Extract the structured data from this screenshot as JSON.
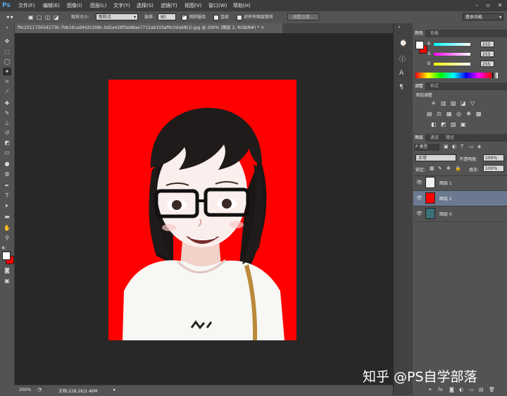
{
  "app": {
    "logo": "Ps"
  },
  "menu": [
    "文件(F)",
    "编辑(E)",
    "图像(I)",
    "图层(L)",
    "文字(Y)",
    "选择(S)",
    "滤镜(T)",
    "视图(V)",
    "窗口(W)",
    "帮助(H)"
  ],
  "options": {
    "sample_size_label": "取样大小:",
    "sample_size_value": "取样点",
    "tolerance_label": "容差:",
    "tolerance_value": "80",
    "antialias_label": "消除锯齿",
    "contiguous_label": "连续",
    "sample_all_label": "对所有图层取样",
    "refine_edge_button": "调整边缘...",
    "workspace_value": "基本功能"
  },
  "document": {
    "tab_title": "f9c23117565d273b-7bb16cad442c208c-0d2a428f3e98ae7712ab103af9c0da68(1).jpg @ 200% (图层 2, RGB/8#) *",
    "close_glyph": "×",
    "zoom": "200%",
    "doc_info": "文档:228.2K/2.46M"
  },
  "color_panel": {
    "tabs": [
      "颜色",
      "色板"
    ],
    "sliders": [
      {
        "label": "R",
        "value": "255",
        "color": "#00ffff"
      },
      {
        "label": "G",
        "value": "255",
        "color": "#ff00ff"
      },
      {
        "label": "B",
        "value": "255",
        "color": "#ffff00"
      }
    ]
  },
  "adjust_panel": {
    "tabs": [
      "调整",
      "样式"
    ],
    "heading": "添加调整",
    "row1": [
      "☀",
      "▥",
      "▨",
      "◪",
      "▽"
    ],
    "row2": [
      "▤",
      "⚖",
      "▦",
      "◎",
      "❖",
      "▩"
    ],
    "row3": [
      "◧",
      "◩",
      "▧",
      "▣"
    ]
  },
  "layers_panel": {
    "tabs": [
      "图层",
      "通道",
      "路径"
    ],
    "filter_label": "P 类型",
    "blend_mode": "正常",
    "opacity_label": "不透明度:",
    "opacity_value": "100%",
    "lock_label": "锁定:",
    "fill_label": "填充:",
    "fill_value": "100%",
    "layers": [
      {
        "name": "图层 1",
        "thumb": "#f0f0f0",
        "selected": false
      },
      {
        "name": "图层 2",
        "thumb": "#ff0000",
        "selected": true
      },
      {
        "name": "图层 0",
        "thumb": "#3a6f75",
        "selected": false
      }
    ]
  },
  "watermark": "知乎 @PS自学部落"
}
